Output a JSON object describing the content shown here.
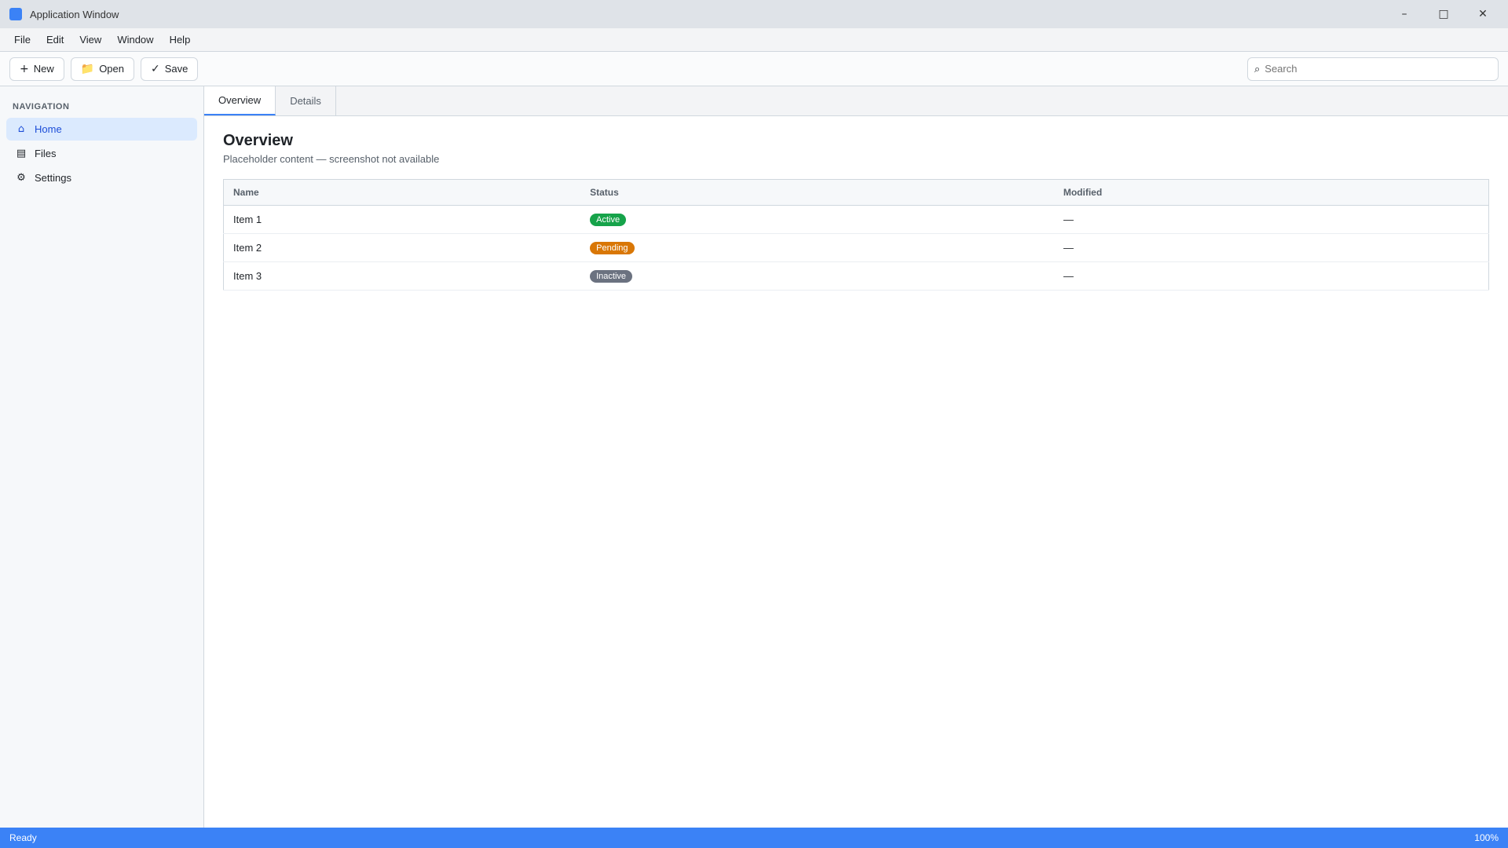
{
  "window": {
    "title": "Application Window"
  },
  "menu": [
    "File",
    "Edit",
    "View",
    "Window",
    "Help"
  ],
  "toolbar": {
    "new_label": "New",
    "open_label": "Open",
    "save_label": "Save",
    "search_placeholder": "Search"
  },
  "sidebar": {
    "heading": "Navigation",
    "items": [
      {
        "label": "Home",
        "icon": "⌂"
      },
      {
        "label": "Files",
        "icon": "▤"
      },
      {
        "label": "Settings",
        "icon": "⚙"
      }
    ]
  },
  "tabs": [
    "Overview",
    "Details"
  ],
  "main": {
    "title": "Overview",
    "subtitle": "Placeholder content — screenshot not available",
    "columns": [
      "Name",
      "Status",
      "Modified"
    ],
    "rows": [
      {
        "name": "Item 1",
        "status": "Active",
        "status_color": "#16a34a",
        "modified": "—"
      },
      {
        "name": "Item 2",
        "status": "Pending",
        "status_color": "#d97706",
        "modified": "—"
      },
      {
        "name": "Item 3",
        "status": "Inactive",
        "status_color": "#6b7280",
        "modified": "—"
      }
    ]
  },
  "status": {
    "left": "Ready",
    "right": "100%"
  },
  "colors": {
    "accent": "#3b82f6"
  }
}
